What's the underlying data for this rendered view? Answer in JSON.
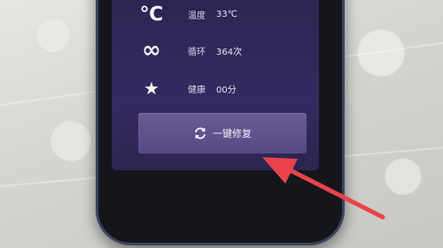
{
  "rows": [
    {
      "icon": "celsius-icon",
      "symbol": "℃",
      "label": "温度",
      "value": "33℃"
    },
    {
      "icon": "infinity-icon",
      "symbol": "∞",
      "label": "循环",
      "value": "364次"
    },
    {
      "icon": "star-icon",
      "symbol": "★",
      "label": "健康",
      "value": "00分"
    }
  ],
  "button": {
    "label": "一键修复",
    "icon": "refresh-icon"
  },
  "colors": {
    "screen": "#2f2859",
    "button": "#6a5a96",
    "arrow": "#e8434a"
  }
}
